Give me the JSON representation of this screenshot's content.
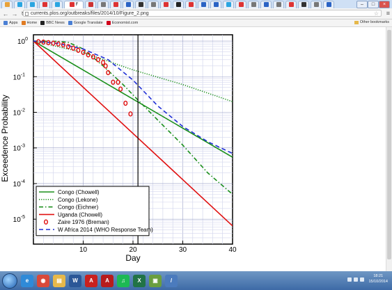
{
  "browser": {
    "url": "currents.plos.org/outbreaks/files/2014/10/Figure_2.png",
    "active_tab_label": "F",
    "bookmarks": [
      {
        "label": "Apps",
        "color": "#4a7fd4"
      },
      {
        "label": "Home",
        "color": "#e07b22"
      },
      {
        "label": "BBC News",
        "color": "#222222"
      },
      {
        "label": "Google Translate",
        "color": "#4a7fd4"
      },
      {
        "label": "Economist.com",
        "color": "#d0021b"
      }
    ],
    "other_bookmarks_label": "Other bookmarks",
    "tab_favicon_colors": [
      "#e8a23a",
      "#2aa5e0",
      "#2aa5e0",
      "#d33",
      "#2aa5e0",
      "#d33",
      "#c33",
      "#777",
      "#d33",
      "#2b63c4",
      "#333",
      "#777",
      "#d33",
      "#222",
      "#d33",
      "#2b63c4",
      "#2b63c4",
      "#2aa5e0",
      "#d33",
      "#777",
      "#2b63c4",
      "#777",
      "#d33",
      "#333",
      "#777",
      "#2b63c4"
    ]
  },
  "taskbar": {
    "apps": [
      {
        "name": "ie-icon",
        "color": "#2f8ad8",
        "glyph": "e"
      },
      {
        "name": "chrome-icon",
        "color": "#d9493a",
        "glyph": "◉"
      },
      {
        "name": "folder-icon",
        "color": "#e6b84a",
        "glyph": "▤"
      },
      {
        "name": "word-icon",
        "color": "#2b5797",
        "glyph": "W"
      },
      {
        "name": "acrobat-icon",
        "color": "#c9211e",
        "glyph": "A"
      },
      {
        "name": "acrobat-reader-icon",
        "color": "#b71c1c",
        "glyph": "A"
      },
      {
        "name": "spotify-icon",
        "color": "#1db954",
        "glyph": "♫"
      },
      {
        "name": "excel-icon",
        "color": "#217346",
        "glyph": "X"
      },
      {
        "name": "image-viewer-icon",
        "color": "#6a9e3f",
        "glyph": "▣"
      },
      {
        "name": "pen-app-icon",
        "color": "#4b7bbd",
        "glyph": "/"
      }
    ],
    "time": "18:21",
    "date": "15/10/2014"
  },
  "chart_data": {
    "type": "line",
    "title": "",
    "xlabel": "Day",
    "ylabel": "Exceedence Probability",
    "x_scale": "linear",
    "y_scale": "log",
    "xlim": [
      0,
      40
    ],
    "ylim": [
      2e-06,
      1.5
    ],
    "x_ticks": [
      10,
      20,
      30,
      40
    ],
    "y_ticks": [
      {
        "value": 1,
        "label": "10",
        "exp": "0"
      },
      {
        "value": 0.1,
        "label": "10",
        "exp": "-1"
      },
      {
        "value": 0.01,
        "label": "10",
        "exp": "-2"
      },
      {
        "value": 0.001,
        "label": "10",
        "exp": "-3"
      },
      {
        "value": 0.0001,
        "label": "10",
        "exp": "-4"
      },
      {
        "value": 1e-05,
        "label": "10",
        "exp": "-5"
      }
    ],
    "grid": true,
    "vertical_line_x": 21,
    "legend_position": "bottom-left",
    "series": [
      {
        "name": "Congo (Chowell)",
        "color": "#1a8f1a",
        "dash": "solid",
        "points": [
          [
            0,
            1
          ],
          [
            40,
            0.00055
          ]
        ]
      },
      {
        "name": "Congo (Lekone)",
        "color": "#1a8f1a",
        "dash": "dotted",
        "points": [
          [
            0,
            1
          ],
          [
            10,
            0.48
          ],
          [
            20,
            0.155
          ],
          [
            30,
            0.06
          ],
          [
            40,
            0.02
          ]
        ]
      },
      {
        "name": "Congo (Eichner)",
        "color": "#1a8f1a",
        "dash": "dashdot",
        "points": [
          [
            0,
            1
          ],
          [
            5,
            0.98
          ],
          [
            7,
            0.92
          ],
          [
            10,
            0.6
          ],
          [
            14,
            0.2
          ],
          [
            18,
            0.06
          ],
          [
            21,
            0.022
          ],
          [
            25,
            0.006
          ],
          [
            30,
            0.0012
          ],
          [
            35,
            0.0002
          ],
          [
            40,
            5e-05
          ]
        ]
      },
      {
        "name": "Uganda (Chowell)",
        "color": "#e01010",
        "dash": "solid",
        "points": [
          [
            0,
            1
          ],
          [
            40,
            6.5e-06
          ]
        ]
      },
      {
        "name": "W Africa 2014 (WHO Response Team)",
        "color": "#1f2fd6",
        "dash": "dashed",
        "points": [
          [
            0,
            1
          ],
          [
            5,
            0.85
          ],
          [
            10,
            0.6
          ],
          [
            15,
            0.3
          ],
          [
            20,
            0.08
          ],
          [
            25,
            0.015
          ],
          [
            30,
            0.004
          ],
          [
            35,
            0.0015
          ],
          [
            40,
            0.0007
          ]
        ]
      }
    ],
    "scatter": {
      "name": "Zaire 1976 (Breman)",
      "color": "#e01010",
      "points": [
        [
          1,
          0.96
        ],
        [
          2,
          0.93
        ],
        [
          3,
          0.9
        ],
        [
          4,
          0.87
        ],
        [
          5,
          0.83
        ],
        [
          6,
          0.78
        ],
        [
          7,
          0.7
        ],
        [
          8,
          0.63
        ],
        [
          9,
          0.55
        ],
        [
          10,
          0.48
        ],
        [
          11,
          0.41
        ],
        [
          12,
          0.36
        ],
        [
          13,
          0.3
        ],
        [
          14,
          0.25
        ],
        [
          14.5,
          0.2
        ],
        [
          15,
          0.13
        ],
        [
          16,
          0.07
        ],
        [
          17,
          0.07
        ],
        [
          17.5,
          0.045
        ],
        [
          18.5,
          0.018
        ],
        [
          19.5,
          0.009
        ]
      ]
    }
  }
}
